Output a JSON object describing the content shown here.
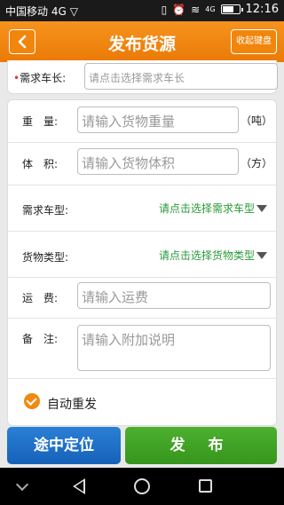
{
  "status_bar": {
    "carrier": "中国移动 4G",
    "time": "12:16",
    "network_label": "4G"
  },
  "header": {
    "title": "发布货源",
    "collapse_keyboard_label": "收起键盘"
  },
  "form_top": {
    "vehicle_length_label": "需求车长:",
    "required_mark": "•",
    "vehicle_length_placeholder": "请点击选择需求车长"
  },
  "form": {
    "weight_label": "重　量:",
    "weight_placeholder": "请输入货物重量",
    "weight_unit": "（吨）",
    "volume_label": "体　积:",
    "volume_placeholder": "请输入货物体积",
    "volume_unit": "（方）",
    "vehicle_type_label": "需求车型:",
    "vehicle_type_picker": "请点击选择需求车型",
    "cargo_type_label": "货物类型:",
    "cargo_type_picker": "请点击选择货物类型",
    "freight_label": "运　费:",
    "freight_placeholder": "请输入运费",
    "remark_label": "备　注:",
    "remark_placeholder": "请输入附加说明",
    "auto_repost_label": "自动重发",
    "auto_repost_checked": true
  },
  "actions": {
    "locate_label": "途中定位",
    "publish_label": "发 布"
  },
  "colors": {
    "header_orange": "#f08a12",
    "locate_blue": "#1f70c8",
    "publish_green": "#3fa326",
    "picker_green": "#2a9a3a"
  }
}
